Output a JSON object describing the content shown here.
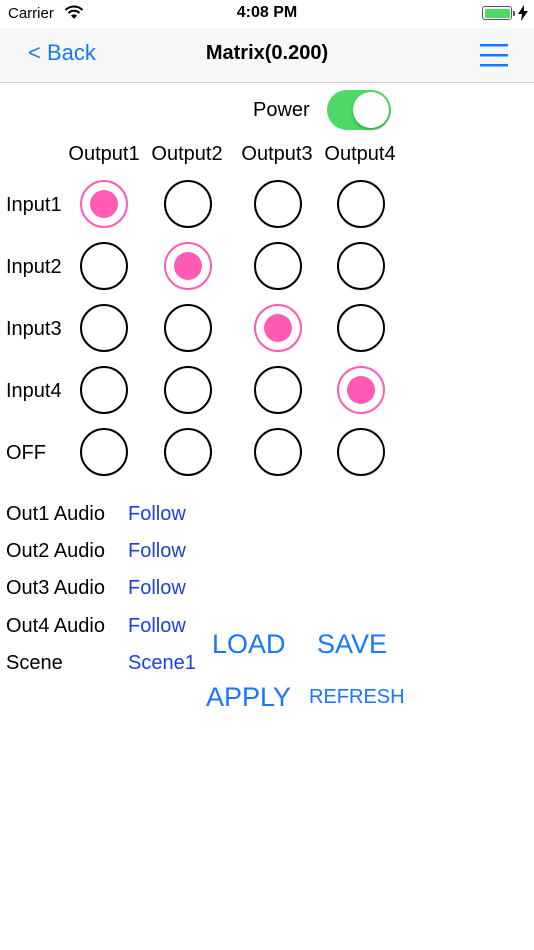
{
  "status": {
    "carrier": "Carrier",
    "time": "4:08 PM"
  },
  "nav": {
    "back_label": "< Back",
    "title": "Matrix(0.200)"
  },
  "power": {
    "label": "Power",
    "on": true
  },
  "outputs": [
    "Output1",
    "Output2",
    "Output3",
    "Output4"
  ],
  "inputs": [
    "Input1",
    "Input2",
    "Input3",
    "Input4",
    "OFF"
  ],
  "selected": [
    0,
    1,
    2,
    3
  ],
  "audio": [
    {
      "label": "Out1 Audio",
      "value": "Follow"
    },
    {
      "label": "Out2 Audio",
      "value": "Follow"
    },
    {
      "label": "Out3 Audio",
      "value": "Follow"
    },
    {
      "label": "Out4 Audio",
      "value": "Follow"
    }
  ],
  "scene": {
    "label": "Scene",
    "value": "Scene1"
  },
  "buttons": {
    "load": "LOAD",
    "save": "SAVE",
    "apply": "APPLY",
    "refresh": "REFRESH"
  },
  "colors": {
    "accent": "#1677ff",
    "selected": "#ff5bb5",
    "switch_on": "#4cd964",
    "link": "#1b3fe0"
  }
}
